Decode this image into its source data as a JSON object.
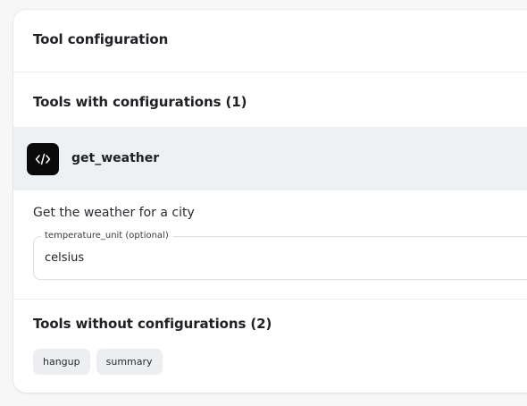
{
  "header": {
    "title": "Tool configuration"
  },
  "with_config": {
    "title": "Tools with configurations (1)",
    "tools": [
      {
        "name": "get_weather",
        "icon": "code-icon",
        "description": "Get the weather for a city",
        "field": {
          "label": "temperature_unit (optional)",
          "value": "celsius"
        }
      }
    ]
  },
  "without_config": {
    "title": "Tools without configurations (2)",
    "tools": [
      "hangup",
      "summary"
    ]
  }
}
